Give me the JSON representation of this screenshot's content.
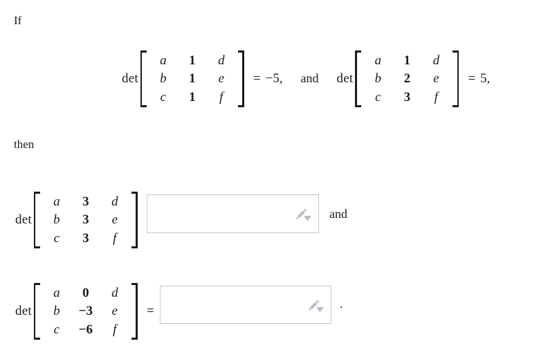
{
  "problem": {
    "intro_word": "If",
    "then_word": "then",
    "conjunction": "and",
    "terminal_punctuation": ".",
    "det_label": "det",
    "equals_sign": "=",
    "comma": ",",
    "given": [
      {
        "matrix": [
          [
            "a",
            "1",
            "d"
          ],
          [
            "b",
            "1",
            "e"
          ],
          [
            "c",
            "1",
            "f"
          ]
        ],
        "value": "−5",
        "trailing": ","
      },
      {
        "matrix": [
          [
            "a",
            "1",
            "d"
          ],
          [
            "b",
            "2",
            "e"
          ],
          [
            "c",
            "3",
            "f"
          ]
        ],
        "value": "5",
        "trailing": ","
      }
    ],
    "questions": [
      {
        "matrix": [
          [
            "a",
            "3",
            "d"
          ],
          [
            "b",
            "3",
            "e"
          ],
          [
            "c",
            "3",
            "f"
          ]
        ],
        "answer_value": "",
        "answer_placeholder": ""
      },
      {
        "matrix": [
          [
            "a",
            "0",
            "d"
          ],
          [
            "b",
            "−3",
            "e"
          ],
          [
            "c",
            "−6",
            "f"
          ]
        ],
        "answer_value": "",
        "answer_placeholder": ""
      }
    ]
  },
  "icons": {
    "pencil": "pencil-icon",
    "caret": "chevron-down-icon"
  },
  "colors": {
    "text": "#1b1b1b",
    "input_border": "#c8c8c8",
    "icon_gray": "#b7bcc2",
    "background": "#ffffff"
  }
}
